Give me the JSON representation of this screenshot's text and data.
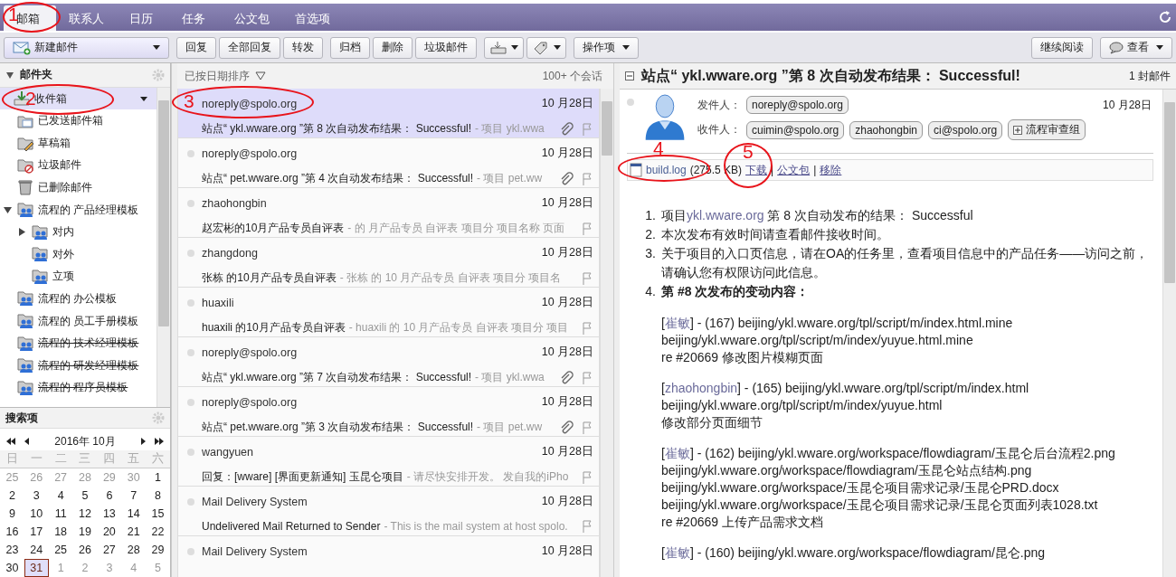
{
  "tabs": [
    {
      "label": "邮箱",
      "selected": true
    },
    {
      "label": "联系人",
      "selected": false
    },
    {
      "label": "日历",
      "selected": false
    },
    {
      "label": "任务",
      "selected": false
    },
    {
      "label": "公文包",
      "selected": false
    },
    {
      "label": "首选项",
      "selected": false
    }
  ],
  "toolbar": {
    "new_mail": "新建邮件",
    "groups": [
      [
        "回复",
        "全部回复",
        "转发"
      ],
      [
        "归档",
        "删除",
        "垃圾邮件"
      ]
    ],
    "actions": "操作项",
    "continue": "继续阅读",
    "view": "查看"
  },
  "sidebar": {
    "title": "邮件夹",
    "expanded": true,
    "folders": [
      {
        "label": "收件箱",
        "kind": "inbox",
        "selected": true,
        "struck": false
      },
      {
        "label": "已发送邮件箱",
        "kind": "sent",
        "selected": false,
        "struck": false
      },
      {
        "label": "草稿箱",
        "kind": "drafts",
        "selected": false,
        "struck": false
      },
      {
        "label": "垃圾邮件",
        "kind": "junk",
        "selected": false,
        "struck": false
      },
      {
        "label": "已删除邮件",
        "kind": "trash",
        "selected": false,
        "struck": false
      },
      {
        "label": "流程的 产品经理模板",
        "kind": "shared",
        "selected": false,
        "struck": false,
        "expanded": true,
        "children": [
          {
            "label": "对内",
            "kind": "shared",
            "selected": false,
            "struck": false,
            "expanded": false
          },
          {
            "label": "对外",
            "kind": "shared",
            "selected": false,
            "struck": false
          },
          {
            "label": "立项",
            "kind": "shared",
            "selected": false,
            "struck": false
          }
        ]
      },
      {
        "label": "流程的 办公模板",
        "kind": "shared",
        "selected": false,
        "struck": false
      },
      {
        "label": "流程的 员工手册模板",
        "kind": "shared",
        "selected": false,
        "struck": false
      },
      {
        "label": "流程的 技术经理模板",
        "kind": "shared",
        "selected": false,
        "struck": true
      },
      {
        "label": "流程的 研发经理模板",
        "kind": "shared",
        "selected": false,
        "struck": true
      },
      {
        "label": "流程的 程序员模板",
        "kind": "shared",
        "selected": false,
        "struck": true
      }
    ],
    "searches_title": "搜索项"
  },
  "calendar": {
    "title": "2016年 10月",
    "weekdays": [
      "日",
      "一",
      "二",
      "三",
      "四",
      "五",
      "六"
    ],
    "weeks": [
      [
        {
          "d": "25",
          "other": true,
          "selected": false
        },
        {
          "d": "26",
          "other": true,
          "selected": false
        },
        {
          "d": "27",
          "other": true,
          "selected": false
        },
        {
          "d": "28",
          "other": true,
          "selected": false
        },
        {
          "d": "29",
          "other": true,
          "selected": false
        },
        {
          "d": "30",
          "other": true,
          "selected": false
        },
        {
          "d": "1",
          "other": false,
          "selected": false
        }
      ],
      [
        {
          "d": "2",
          "other": false,
          "selected": false
        },
        {
          "d": "3",
          "other": false,
          "selected": false
        },
        {
          "d": "4",
          "other": false,
          "selected": false
        },
        {
          "d": "5",
          "other": false,
          "selected": false
        },
        {
          "d": "6",
          "other": false,
          "selected": false
        },
        {
          "d": "7",
          "other": false,
          "selected": false
        },
        {
          "d": "8",
          "other": false,
          "selected": false
        }
      ],
      [
        {
          "d": "9",
          "other": false,
          "selected": false
        },
        {
          "d": "10",
          "other": false,
          "selected": false
        },
        {
          "d": "11",
          "other": false,
          "selected": false
        },
        {
          "d": "12",
          "other": false,
          "selected": false
        },
        {
          "d": "13",
          "other": false,
          "selected": false
        },
        {
          "d": "14",
          "other": false,
          "selected": false
        },
        {
          "d": "15",
          "other": false,
          "selected": false
        }
      ],
      [
        {
          "d": "16",
          "other": false,
          "selected": false
        },
        {
          "d": "17",
          "other": false,
          "selected": false
        },
        {
          "d": "18",
          "other": false,
          "selected": false
        },
        {
          "d": "19",
          "other": false,
          "selected": false
        },
        {
          "d": "20",
          "other": false,
          "selected": false
        },
        {
          "d": "21",
          "other": false,
          "selected": false
        },
        {
          "d": "22",
          "other": false,
          "selected": false
        }
      ],
      [
        {
          "d": "23",
          "other": false,
          "selected": false
        },
        {
          "d": "24",
          "other": false,
          "selected": false
        },
        {
          "d": "25",
          "other": false,
          "selected": false
        },
        {
          "d": "26",
          "other": false,
          "selected": false
        },
        {
          "d": "27",
          "other": false,
          "selected": false
        },
        {
          "d": "28",
          "other": false,
          "selected": false
        },
        {
          "d": "29",
          "other": false,
          "selected": false
        }
      ],
      [
        {
          "d": "30",
          "other": false,
          "selected": false
        },
        {
          "d": "31",
          "other": false,
          "selected": true
        },
        {
          "d": "1",
          "other": true,
          "selected": false
        },
        {
          "d": "2",
          "other": true,
          "selected": false
        },
        {
          "d": "3",
          "other": true,
          "selected": false
        },
        {
          "d": "4",
          "other": true,
          "selected": false
        },
        {
          "d": "5",
          "other": true,
          "selected": false
        }
      ]
    ]
  },
  "list": {
    "sort": "已按日期排序",
    "count": "100+ 个会话",
    "messages": [
      {
        "sender": "noreply@spolo.org",
        "date": "10 月28日",
        "subject": "站点“ ykl.wware.org ”第 8 次自动发布结果：  Successful!",
        "preview": "- 项目 ykl.wwa",
        "attachment": true,
        "unread": false,
        "selected": true
      },
      {
        "sender": "noreply@spolo.org",
        "date": "10 月28日",
        "subject": "站点“ pet.wware.org ”第 4 次自动发布结果：  Successful!",
        "preview": "- 项目 pet.ww",
        "attachment": true,
        "unread": true,
        "selected": false
      },
      {
        "sender": "zhaohongbin",
        "date": "10 月28日",
        "subject": "赵宏彬的10月产品专员自评表",
        "preview": "- 的 月产品专员 自评表 项目分 项目名称 页面",
        "attachment": false,
        "unread": true,
        "selected": false
      },
      {
        "sender": "zhangdong",
        "date": "10 月28日",
        "subject": "张栋 的10月产品专员自评表",
        "preview": "- 张栋 的 10 月产品专员 自评表 项目分 项目名",
        "attachment": false,
        "unread": true,
        "selected": false
      },
      {
        "sender": "huaxili",
        "date": "10 月28日",
        "subject": "huaxili 的10月产品专员自评表",
        "preview": "- huaxili 的 10 月产品专员 自评表 项目分 项目",
        "attachment": false,
        "unread": true,
        "selected": false
      },
      {
        "sender": "noreply@spolo.org",
        "date": "10 月28日",
        "subject": "站点“ ykl.wware.org ”第 7 次自动发布结果：  Successful!",
        "preview": "- 项目 ykl.wwa",
        "attachment": true,
        "unread": true,
        "selected": false
      },
      {
        "sender": "noreply@spolo.org",
        "date": "10 月28日",
        "subject": "站点“ pet.wware.org ”第 3 次自动发布结果：  Successful!",
        "preview": "- 项目 pet.ww",
        "attachment": true,
        "unread": true,
        "selected": false
      },
      {
        "sender": "wangyuen",
        "date": "10 月28日",
        "subject": "回复：[wware] [界面更新通知] 玉昆仑项目",
        "preview": "- 请尽快安排开发。 发自我的iPho",
        "attachment": false,
        "unread": true,
        "selected": false
      },
      {
        "sender": "Mail Delivery System",
        "date": "10 月28日",
        "subject": "Undelivered Mail Returned to Sender",
        "preview": "- This is the mail system at host spolo.",
        "attachment": false,
        "unread": true,
        "selected": false
      },
      {
        "sender": "Mail Delivery System",
        "date": "10 月28日",
        "unread": true,
        "selected": false
      }
    ]
  },
  "reader": {
    "title": "站点“ ykl.wware.org ”第 8 次自动发布结果：  Successful!",
    "count": "1 封邮件",
    "from_label": "发件人：",
    "from": "noreply@spolo.org",
    "date": "10 月28日",
    "to_label": "收件人：",
    "to": [
      {
        "name": "cuimin@spolo.org",
        "kind": "person"
      },
      {
        "name": "zhaohongbin",
        "kind": "person"
      },
      {
        "name": "ci@spolo.org",
        "kind": "person"
      },
      {
        "name": "流程审查组",
        "kind": "group"
      }
    ],
    "attachment": {
      "name": "build.log",
      "size": "(275.5 KB)",
      "links": [
        "下载",
        "公文包",
        "移除"
      ],
      "sep": "|"
    },
    "items": [
      {
        "num": "1.",
        "text": "项目",
        "link": "ykl.wware.org",
        "after": "第 8 次自动发布的结果：  Successful",
        "bold": false
      },
      {
        "num": "2.",
        "text": "本次发布有效时间请查看邮件接收时间。",
        "bold": false
      },
      {
        "num": "3.",
        "text": "关于项目的入口页信息，请在OA的任务里，查看项目信息中的产品任务——访问之前，请确认您有权限访问此信息。",
        "bold": false
      },
      {
        "num": "4.",
        "text": "第 #8 次发布的变动内容：",
        "bold": true
      }
    ],
    "changes": [
      {
        "lead": "[",
        "author": "崔敏",
        "text": "] - (167) beijing/ykl.wware.org/tpl/script/m/index.html.mine",
        "lines": [
          "beijing/ykl.wware.org/tpl/script/m/index/yuyue.html.mine",
          "re #20669 修改图片模糊页面"
        ]
      },
      {
        "lead": "[",
        "author": "zhaohongbin",
        "text": "] - (165) beijing/ykl.wware.org/tpl/script/m/index.html",
        "lines": [
          "beijing/ykl.wware.org/tpl/script/m/index/yuyue.html",
          "修改部分页面细节"
        ]
      },
      {
        "lead": "[",
        "author": "崔敏",
        "text": "] - (162) beijing/ykl.wware.org/workspace/flowdiagram/玉昆仑后台流程2.png",
        "lines": [
          "beijing/ykl.wware.org/workspace/flowdiagram/玉昆仑站点结构.png",
          "beijing/ykl.wware.org/workspace/玉昆仑项目需求记录/玉昆仑PRD.docx",
          "beijing/ykl.wware.org/workspace/玉昆仑项目需求记录/玉昆仑页面列表1028.txt",
          "re #20669 上传产品需求文档"
        ]
      },
      {
        "lead": "[",
        "author": "崔敏",
        "text": "] - (160) beijing/ykl.wware.org/workspace/flowdiagram/昆仑.png"
      }
    ]
  },
  "annotations": [
    {
      "number": "1"
    },
    {
      "number": "2"
    },
    {
      "number": "3"
    },
    {
      "number": "4"
    },
    {
      "number": "5"
    }
  ]
}
